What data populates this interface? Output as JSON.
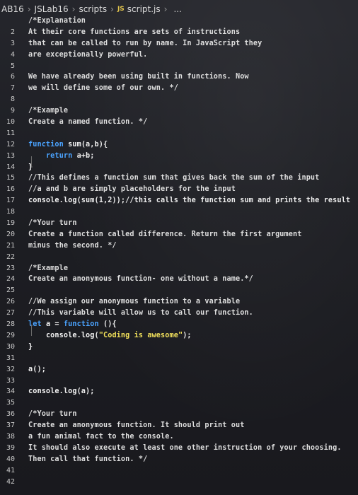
{
  "breadcrumb": {
    "items": [
      "AB16",
      "JSLab16",
      "scripts",
      "script.js"
    ],
    "js_badge": "JS",
    "ellipsis": "..."
  },
  "lines": [
    {
      "n": "",
      "tokens": [
        [
          "cm",
          "/*Explanation"
        ]
      ]
    },
    {
      "n": "2",
      "tokens": [
        [
          "cm",
          "At their core functions are sets of instructions"
        ]
      ]
    },
    {
      "n": "3",
      "tokens": [
        [
          "cm",
          "that can be called to run by name. In JavaScript they"
        ]
      ]
    },
    {
      "n": "4",
      "tokens": [
        [
          "cm",
          "are exceptionally powerful."
        ]
      ]
    },
    {
      "n": "5",
      "tokens": []
    },
    {
      "n": "6",
      "tokens": [
        [
          "cm",
          "We have already been using built in functions. Now"
        ]
      ]
    },
    {
      "n": "7",
      "tokens": [
        [
          "cm",
          "we will define some of our own. */"
        ]
      ]
    },
    {
      "n": "8",
      "tokens": []
    },
    {
      "n": "9",
      "tokens": [
        [
          "cm",
          "/*Example"
        ]
      ]
    },
    {
      "n": "10",
      "tokens": [
        [
          "cm",
          "Create a named function. */"
        ]
      ]
    },
    {
      "n": "11",
      "tokens": []
    },
    {
      "n": "12",
      "tokens": [
        [
          "kw",
          "function "
        ],
        [
          "fn",
          "sum"
        ],
        [
          "pl",
          "(a,b){"
        ]
      ]
    },
    {
      "n": "13",
      "tokens": [
        [
          "pl",
          "    "
        ],
        [
          "kw",
          "return "
        ],
        [
          "pl",
          "a+b;"
        ]
      ]
    },
    {
      "n": "14",
      "tokens": [
        [
          "br",
          "}"
        ]
      ]
    },
    {
      "n": "15",
      "tokens": [
        [
          "cm",
          "//This defines a function sum that gives back the sum of the input"
        ]
      ]
    },
    {
      "n": "16",
      "tokens": [
        [
          "cm",
          "//a and b are simply placeholders for the input"
        ]
      ]
    },
    {
      "n": "17",
      "tokens": [
        [
          "fn",
          "console"
        ],
        [
          "pl",
          "."
        ],
        [
          "fn",
          "log"
        ],
        [
          "pl",
          "(sum(1,2));//this calls the function sum and prints the result"
        ]
      ]
    },
    {
      "n": "18",
      "tokens": []
    },
    {
      "n": "19",
      "tokens": [
        [
          "cm",
          "/*Your turn"
        ]
      ]
    },
    {
      "n": "20",
      "tokens": [
        [
          "cm",
          "Create a function called difference. Return the first argument"
        ]
      ]
    },
    {
      "n": "21",
      "tokens": [
        [
          "cm",
          "minus the second. */"
        ]
      ]
    },
    {
      "n": "22",
      "tokens": []
    },
    {
      "n": "23",
      "tokens": [
        [
          "cm",
          "/*Example"
        ]
      ]
    },
    {
      "n": "24",
      "tokens": [
        [
          "cm",
          "Create an anonymous function- one without a name.*/"
        ]
      ]
    },
    {
      "n": "25",
      "tokens": []
    },
    {
      "n": "26",
      "tokens": [
        [
          "cm",
          "//We assign our anonymous function to a variable"
        ]
      ]
    },
    {
      "n": "27",
      "tokens": [
        [
          "cm",
          "//This variable will allow us to call our function."
        ]
      ]
    },
    {
      "n": "28",
      "tokens": [
        [
          "kw",
          "let "
        ],
        [
          "pl",
          "a = "
        ],
        [
          "kw",
          "function "
        ],
        [
          "pl",
          "(){"
        ]
      ]
    },
    {
      "n": "29",
      "tokens": [
        [
          "pl",
          "    "
        ],
        [
          "fn",
          "console"
        ],
        [
          "pl",
          "."
        ],
        [
          "fn",
          "log"
        ],
        [
          "pl",
          "("
        ],
        [
          "str",
          "\"Coding is awesome\""
        ],
        [
          "pl",
          ");"
        ]
      ]
    },
    {
      "n": "30",
      "tokens": [
        [
          "br",
          "}"
        ]
      ]
    },
    {
      "n": "31",
      "tokens": []
    },
    {
      "n": "32",
      "tokens": [
        [
          "pl",
          "a();"
        ]
      ]
    },
    {
      "n": "33",
      "tokens": []
    },
    {
      "n": "34",
      "tokens": [
        [
          "fn",
          "console"
        ],
        [
          "pl",
          "."
        ],
        [
          "fn",
          "log"
        ],
        [
          "pl",
          "(a);"
        ]
      ]
    },
    {
      "n": "35",
      "tokens": []
    },
    {
      "n": "36",
      "tokens": [
        [
          "cm",
          "/*Your turn"
        ]
      ]
    },
    {
      "n": "37",
      "tokens": [
        [
          "cm",
          "Create an anonymous function. It should print out"
        ]
      ]
    },
    {
      "n": "38",
      "tokens": [
        [
          "cm",
          "a fun animal fact to the console."
        ]
      ]
    },
    {
      "n": "39",
      "tokens": [
        [
          "cm",
          "It should also execute at least one other instruction of your choosing."
        ]
      ]
    },
    {
      "n": "40",
      "tokens": [
        [
          "cm",
          "Then call that function. */"
        ]
      ]
    },
    {
      "n": "41",
      "tokens": []
    },
    {
      "n": "42",
      "tokens": []
    }
  ]
}
